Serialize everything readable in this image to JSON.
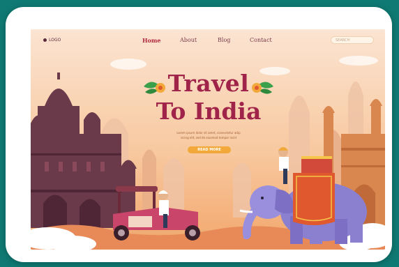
{
  "nav": {
    "logo": "LOGO",
    "links": [
      "Home",
      "About",
      "Blog",
      "Contact"
    ],
    "search_placeholder": "SEARCH"
  },
  "hero": {
    "title_line1": "Travel",
    "title_line2": "To India",
    "description_line1": "Lorem ipsum dolor sit amet, consectetur adip",
    "description_line2": "iscing elit, sed do eiusmod tempor incid",
    "cta_label": "READ MORE"
  },
  "colors": {
    "frame": "#0f7a73",
    "title": "#a0244a",
    "cta": "#f2a93a",
    "elephant": "#8b7fd0"
  }
}
